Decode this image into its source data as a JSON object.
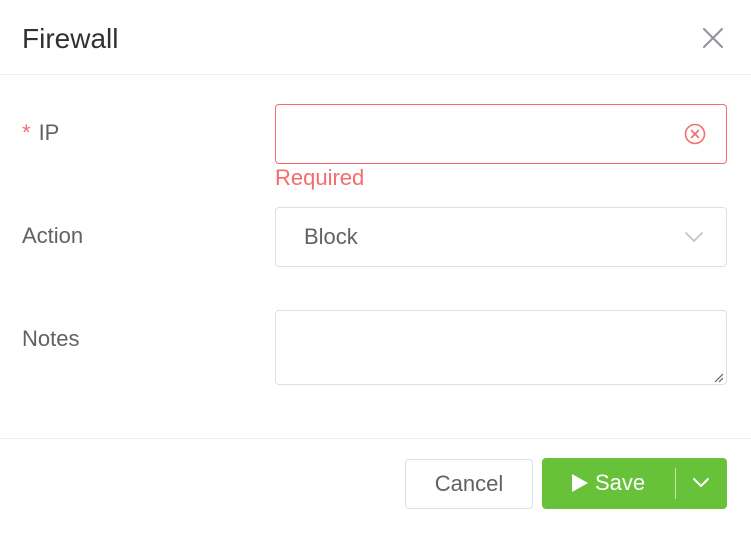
{
  "dialog": {
    "title": "Firewall",
    "close_icon": "close-icon"
  },
  "form": {
    "ip": {
      "label": "IP",
      "required_mark": "*",
      "value": "",
      "placeholder": "",
      "error": "Required",
      "clear_icon": "circle-x-icon"
    },
    "action": {
      "label": "Action",
      "selected": "Block",
      "arrow_icon": "chevron-down-icon"
    },
    "notes": {
      "label": "Notes",
      "value": "",
      "placeholder": ""
    }
  },
  "footer": {
    "cancel_label": "Cancel",
    "save_label": "Save",
    "save_icon": "play-icon",
    "dropdown_icon": "chevron-down-icon"
  },
  "colors": {
    "error": "#f56c6c",
    "success": "#67c23a",
    "border": "#dcdfe6",
    "text": "#606266"
  }
}
